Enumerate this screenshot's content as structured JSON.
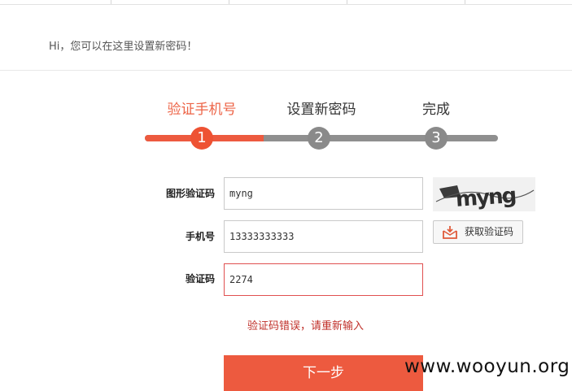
{
  "header": {
    "greeting": "Hi，您可以在这里设置新密码！"
  },
  "steps": [
    {
      "label": "验证手机号",
      "number": "1",
      "active": true
    },
    {
      "label": "设置新密码",
      "number": "2",
      "active": false
    },
    {
      "label": "完成",
      "number": "3",
      "active": false
    }
  ],
  "form": {
    "captcha_label": "图形验证码",
    "captcha_value": "myng",
    "captcha_image_text": "myng",
    "phone_label": "手机号",
    "phone_value": "13333333333",
    "sms_code_label": "验证码",
    "sms_code_value": "2274",
    "get_code_button": "获取验证码",
    "error_message": "验证码错误，请重新输入",
    "next_button": "下一步"
  },
  "watermark": "www.wooyun.org",
  "colors": {
    "accent": "#ed5a3f",
    "inactive": "#8f8f8f",
    "error": "#c0302a"
  }
}
